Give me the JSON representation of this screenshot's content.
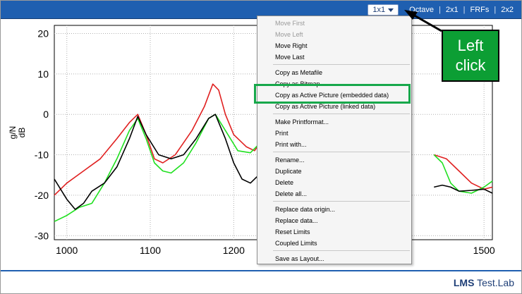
{
  "tabs": [
    {
      "label": "1x1",
      "active": true
    },
    {
      "label": "Octave",
      "active": false
    },
    {
      "label": "2x1",
      "active": false
    },
    {
      "label": "FRFs",
      "active": false
    },
    {
      "label": "2x2",
      "active": false
    }
  ],
  "brand": {
    "bold": "LMS",
    "rest": " Test.Lab"
  },
  "callout": {
    "line1": "Left",
    "line2": "click",
    "color": "#0c9e34"
  },
  "menu": {
    "items": [
      {
        "label": "Move First",
        "disabled": true
      },
      {
        "label": "Move Left",
        "disabled": true
      },
      {
        "label": "Move Right",
        "disabled": false
      },
      {
        "label": "Move Last",
        "disabled": false
      },
      {
        "sep": true
      },
      {
        "label": "Copy as Metafile",
        "disabled": false
      },
      {
        "label": "Copy as Bitmap",
        "disabled": false
      },
      {
        "label": "Copy as Active Picture (embedded data)",
        "disabled": false,
        "highlighted": true
      },
      {
        "label": "Copy as Active Picture (linked data)",
        "disabled": false
      },
      {
        "sep": true
      },
      {
        "label": "Make Printformat...",
        "disabled": false
      },
      {
        "label": "Print",
        "disabled": false
      },
      {
        "label": "Print with...",
        "disabled": false
      },
      {
        "sep": true
      },
      {
        "label": "Rename...",
        "disabled": false
      },
      {
        "label": "Duplicate",
        "disabled": false
      },
      {
        "label": "Delete",
        "disabled": false
      },
      {
        "label": "Delete all...",
        "disabled": false
      },
      {
        "sep": true
      },
      {
        "label": "Replace data origin...",
        "disabled": false
      },
      {
        "label": "Replace data...",
        "disabled": false
      },
      {
        "label": "Reset Limits",
        "disabled": false
      },
      {
        "label": "Coupled Limits",
        "disabled": false
      },
      {
        "sep": true
      },
      {
        "label": "Save as Layout...",
        "disabled": false
      }
    ]
  },
  "chart_data": {
    "type": "line",
    "xlabel": "",
    "ylabel_lines": [
      "g/N",
      "dB"
    ],
    "xlim": [
      985,
      1510
    ],
    "ylim": [
      -31,
      22
    ],
    "xticks": [
      1000,
      1100,
      1200,
      1300,
      1400,
      1500
    ],
    "yticks": [
      20,
      10,
      0,
      -10,
      -20,
      -30
    ],
    "xtick_labels_visible": [
      "1000",
      "1100",
      "1200",
      "00",
      "1500"
    ],
    "series": [
      {
        "color": "#e02020",
        "x": [
          985,
          1000,
          1020,
          1040,
          1060,
          1075,
          1085,
          1095,
          1105,
          1115,
          1130,
          1150,
          1165,
          1175,
          1182,
          1190,
          1200,
          1215,
          1225,
          1235,
          1245
        ],
        "y": [
          -20,
          -17,
          -14,
          -11,
          -6,
          -2,
          0,
          -5,
          -11,
          -12,
          -10,
          -4,
          2,
          7.5,
          6,
          0,
          -5,
          -8,
          -9,
          -6,
          -1
        ]
      },
      {
        "color": "#20e020",
        "x": [
          985,
          1000,
          1015,
          1030,
          1045,
          1060,
          1075,
          1085,
          1095,
          1105,
          1115,
          1125,
          1140,
          1155,
          1170,
          1178,
          1190,
          1205,
          1220,
          1232,
          1245
        ],
        "y": [
          -26.5,
          -25,
          -23,
          -22,
          -17,
          -11,
          -4,
          -1,
          -6,
          -12,
          -14,
          -14.5,
          -12,
          -7,
          -1,
          0,
          -4,
          -9,
          -9.5,
          -7,
          -4
        ]
      },
      {
        "color": "#000000",
        "x": [
          985,
          1000,
          1010,
          1020,
          1030,
          1045,
          1060,
          1075,
          1085,
          1095,
          1110,
          1125,
          1140,
          1155,
          1170,
          1178,
          1190,
          1200,
          1210,
          1220,
          1230,
          1245
        ],
        "y": [
          -16,
          -21,
          -23.5,
          -22,
          -19,
          -17,
          -13,
          -6,
          -0.5,
          -5,
          -10,
          -11,
          -10,
          -6,
          -1,
          0,
          -6,
          -12,
          -16,
          -17,
          -15,
          -12.5
        ]
      },
      {
        "color": "#e02020",
        "x": [
          1440,
          1455,
          1470,
          1485,
          1500,
          1510
        ],
        "y": [
          -10,
          -11,
          -14,
          -17,
          -18.5,
          -18
        ]
      },
      {
        "color": "#20e020",
        "x": [
          1440,
          1450,
          1460,
          1470,
          1485,
          1500,
          1510
        ],
        "y": [
          -10,
          -12,
          -17,
          -19,
          -19.5,
          -18,
          -16.5
        ]
      },
      {
        "color": "#000000",
        "x": [
          1440,
          1450,
          1460,
          1470,
          1485,
          1500,
          1510
        ],
        "y": [
          -18,
          -17.5,
          -18,
          -19,
          -18.8,
          -18.5,
          -19.5
        ]
      }
    ]
  }
}
